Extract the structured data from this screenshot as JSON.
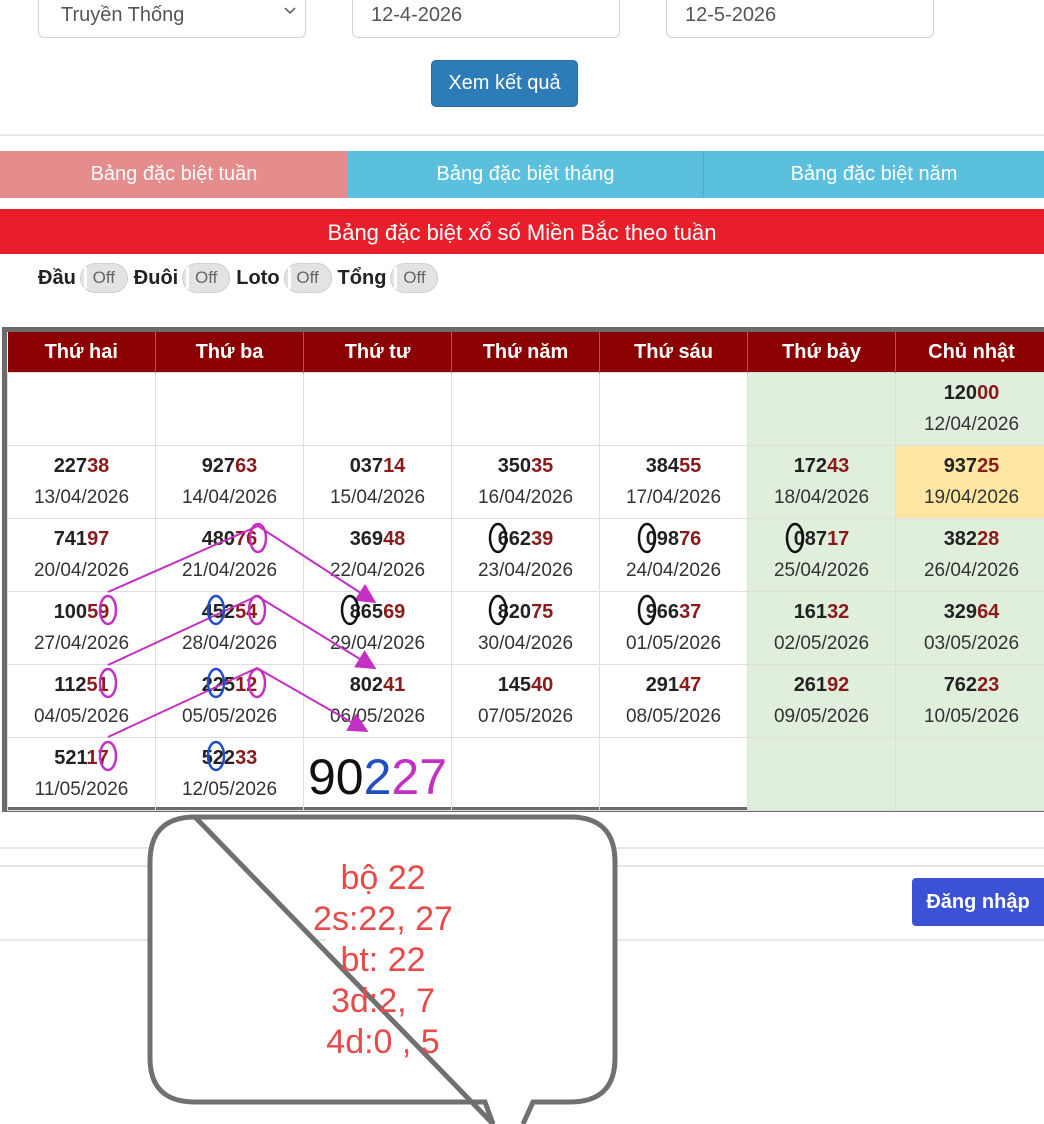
{
  "filters": {
    "type_value": "Truyền Thống",
    "date_from": "12-4-2026",
    "date_to": "12-5-2026",
    "view_button": "Xem kết quả"
  },
  "tabs": [
    "Bảng đặc biệt tuần",
    "Bảng đặc biệt tháng",
    "Bảng đặc biệt năm"
  ],
  "banner": "Bảng đặc biệt xổ số Miền Bắc theo tuần",
  "toggles": [
    {
      "label": "Đầu",
      "state": "Off"
    },
    {
      "label": "Đuôi",
      "state": "Off"
    },
    {
      "label": "Loto",
      "state": "Off"
    },
    {
      "label": "Tổng",
      "state": "Off"
    }
  ],
  "table": {
    "headers": [
      "Thứ hai",
      "Thứ ba",
      "Thứ tư",
      "Thứ năm",
      "Thứ sáu",
      "Thứ bảy",
      "Chủ nhật"
    ],
    "rows": [
      [
        {
          "head": "",
          "tail": "",
          "date": ""
        },
        {
          "head": "",
          "tail": "",
          "date": ""
        },
        {
          "head": "",
          "tail": "",
          "date": ""
        },
        {
          "head": "",
          "tail": "",
          "date": ""
        },
        {
          "head": "",
          "tail": "",
          "date": ""
        },
        {
          "head": "",
          "tail": "",
          "date": ""
        },
        {
          "head": "120",
          "tail": "00",
          "date": "12/04/2026"
        }
      ],
      [
        {
          "head": "227",
          "tail": "38",
          "date": "13/04/2026"
        },
        {
          "head": "927",
          "tail": "63",
          "date": "14/04/2026"
        },
        {
          "head": "037",
          "tail": "14",
          "date": "15/04/2026"
        },
        {
          "head": "350",
          "tail": "35",
          "date": "16/04/2026"
        },
        {
          "head": "384",
          "tail": "55",
          "date": "17/04/2026"
        },
        {
          "head": "172",
          "tail": "43",
          "date": "18/04/2026"
        },
        {
          "head": "937",
          "tail": "25",
          "date": "19/04/2026"
        }
      ],
      [
        {
          "head": "741",
          "tail": "97",
          "date": "20/04/2026"
        },
        {
          "head": "480",
          "tail": "76",
          "date": "21/04/2026"
        },
        {
          "head": "369",
          "tail": "48",
          "date": "22/04/2026"
        },
        {
          "head": "662",
          "tail": "39",
          "date": "23/04/2026"
        },
        {
          "head": "098",
          "tail": "76",
          "date": "24/04/2026"
        },
        {
          "head": "087",
          "tail": "17",
          "date": "25/04/2026"
        },
        {
          "head": "382",
          "tail": "28",
          "date": "26/04/2026"
        }
      ],
      [
        {
          "head": "100",
          "tail": "59",
          "date": "27/04/2026"
        },
        {
          "head": "452",
          "tail": "54",
          "date": "28/04/2026"
        },
        {
          "head": "865",
          "tail": "69",
          "date": "29/04/2026"
        },
        {
          "head": "820",
          "tail": "75",
          "date": "30/04/2026"
        },
        {
          "head": "966",
          "tail": "37",
          "date": "01/05/2026"
        },
        {
          "head": "161",
          "tail": "32",
          "date": "02/05/2026"
        },
        {
          "head": "329",
          "tail": "64",
          "date": "03/05/2026"
        }
      ],
      [
        {
          "head": "112",
          "tail": "51",
          "date": "04/05/2026"
        },
        {
          "head": "225",
          "tail": "12",
          "date": "05/05/2026"
        },
        {
          "head": "802",
          "tail": "41",
          "date": "06/05/2026"
        },
        {
          "head": "145",
          "tail": "40",
          "date": "07/05/2026"
        },
        {
          "head": "291",
          "tail": "47",
          "date": "08/05/2026"
        },
        {
          "head": "261",
          "tail": "92",
          "date": "09/05/2026"
        },
        {
          "head": "762",
          "tail": "23",
          "date": "10/05/2026"
        }
      ],
      [
        {
          "head": "521",
          "tail": "17",
          "date": "11/05/2026"
        },
        {
          "head": "522",
          "tail": "33",
          "date": "12/05/2026"
        },
        {
          "head": "",
          "tail": "",
          "date": ""
        },
        {
          "head": "",
          "tail": "",
          "date": ""
        },
        {
          "head": "",
          "tail": "",
          "date": ""
        },
        {
          "head": "",
          "tail": "",
          "date": ""
        },
        {
          "head": "",
          "tail": "",
          "date": ""
        }
      ]
    ]
  },
  "big_number": {
    "a": "90",
    "b": "2",
    "c": "27"
  },
  "note_lines": [
    "bộ 22",
    "2s:22, 27",
    "bt: 22",
    "3d:2, 7",
    "4d:0 , 5"
  ],
  "login_button": "Đăng nhập",
  "colors": {
    "primary_button": "#2e7cb7",
    "tab_active": "#e48d8c",
    "tab_inactive": "#5bc0de",
    "banner": "#e81f2b",
    "table_header": "#8b0000",
    "weekend_cell": "#dfefdc",
    "highlight_cell": "#ffe7a3",
    "annotation_pink": "#c42fc4",
    "annotation_blue": "#1f4fc4",
    "note_text": "#e84a4a",
    "login_button": "#3b52d6"
  }
}
